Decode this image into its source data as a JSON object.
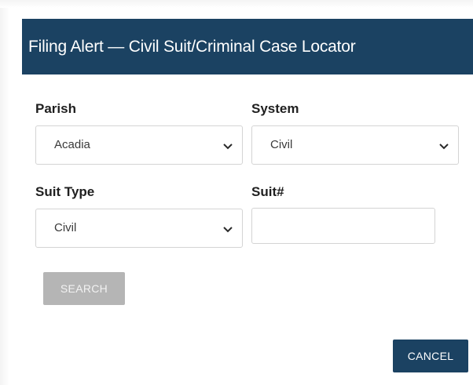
{
  "dialog": {
    "title": "Filing Alert — Civil Suit/Criminal Case Locator"
  },
  "form": {
    "parish": {
      "label": "Parish",
      "value": "Acadia"
    },
    "system": {
      "label": "System",
      "value": "Civil"
    },
    "suit_type": {
      "label": "Suit Type",
      "value": "Civil"
    },
    "suit_number": {
      "label": "Suit#",
      "value": ""
    }
  },
  "buttons": {
    "search": "SEARCH",
    "cancel": "CANCEL"
  },
  "colors": {
    "header_bg": "#1b4262",
    "search_disabled_bg": "#b5b5b5",
    "cancel_bg": "#1b4262"
  },
  "icons": {
    "dropdown": "chevron-down-icon"
  }
}
